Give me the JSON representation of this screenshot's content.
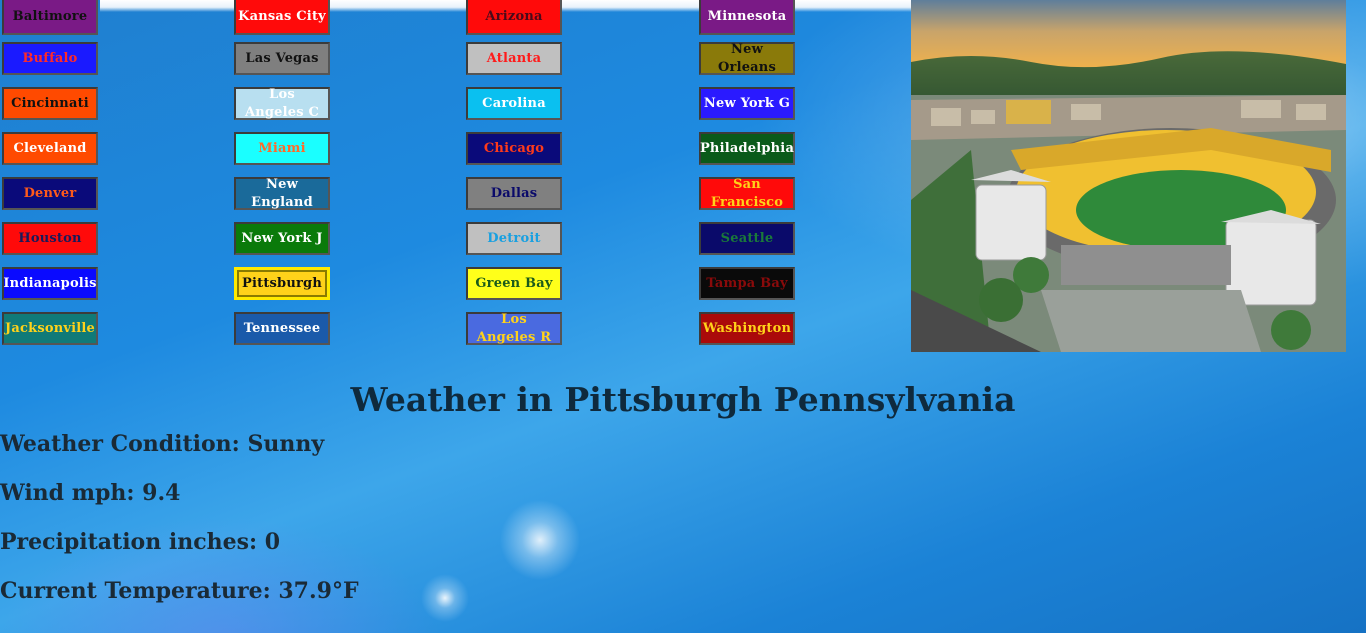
{
  "teams": {
    "col1": [
      {
        "label": "Baltimore",
        "bg": "#7a1a86",
        "fg": "#111111"
      },
      {
        "label": "Buffalo",
        "bg": "#1a1aff",
        "fg": "#ff2a2a"
      },
      {
        "label": "Cincinnati",
        "bg": "#ff4a00",
        "fg": "#111111"
      },
      {
        "label": "Cleveland",
        "bg": "#ff4a00",
        "fg": "#ffffff"
      },
      {
        "label": "Denver",
        "bg": "#0a0a7a",
        "fg": "#ff5a1a"
      },
      {
        "label": "Houston",
        "bg": "#ff0a0a",
        "fg": "#1a1a5a"
      },
      {
        "label": "Indianapolis",
        "bg": "#0a0aff",
        "fg": "#ffffff"
      },
      {
        "label": "Jacksonville",
        "bg": "#107a78",
        "fg": "#ffd21a"
      }
    ],
    "col2": [
      {
        "label": "Kansas City",
        "bg": "#ff0a0a",
        "fg": "#ffffff"
      },
      {
        "label": "Las Vegas",
        "bg": "#7f7f7f",
        "fg": "#111111"
      },
      {
        "label": "Los Angeles C",
        "bg": "#b8dff0",
        "fg": "#ffffff"
      },
      {
        "label": "Miami",
        "bg": "#1affff",
        "fg": "#ff6a2a"
      },
      {
        "label": "New England",
        "bg": "#1a6a9a",
        "fg": "#ffffff"
      },
      {
        "label": "New York J",
        "bg": "#0a7a0a",
        "fg": "#ffffff"
      },
      {
        "label": "Pittsburgh",
        "bg": "#ffd21a",
        "fg": "#111111",
        "active": true
      },
      {
        "label": "Tennessee",
        "bg": "#1a5aaa",
        "fg": "#ffffff"
      }
    ],
    "col3": [
      {
        "label": "Arizona",
        "bg": "#ff0a0a",
        "fg": "#4a0a1a"
      },
      {
        "label": "Atlanta",
        "bg": "#c0c0c0",
        "fg": "#ff1a1a"
      },
      {
        "label": "Carolina",
        "bg": "#0ac0f0",
        "fg": "#ffffff"
      },
      {
        "label": "Chicago",
        "bg": "#0a0a7a",
        "fg": "#ff3a1a"
      },
      {
        "label": "Dallas",
        "bg": "#808080",
        "fg": "#0a0a6a"
      },
      {
        "label": "Detroit",
        "bg": "#c0c0c0",
        "fg": "#1aa0e0"
      },
      {
        "label": "Green Bay",
        "bg": "#ffff1a",
        "fg": "#1a5a1a"
      },
      {
        "label": "Los Angeles R",
        "bg": "#4a6ae0",
        "fg": "#ffd21a"
      }
    ],
    "col4": [
      {
        "label": "Minnesota",
        "bg": "#7a1a86",
        "fg": "#ffffff"
      },
      {
        "label": "New Orleans",
        "bg": "#8a7a0a",
        "fg": "#111111"
      },
      {
        "label": "New York G",
        "bg": "#2a1aff",
        "fg": "#ffffff"
      },
      {
        "label": "Philadelphia",
        "bg": "#0a5a1a",
        "fg": "#ffffff"
      },
      {
        "label": "San Francisco",
        "bg": "#ff0a0a",
        "fg": "#ffd21a"
      },
      {
        "label": "Seattle",
        "bg": "#0a0a6a",
        "fg": "#1a7a3a"
      },
      {
        "label": "Tampa Bay",
        "bg": "#0a0a0a",
        "fg": "#8a0a0a"
      },
      {
        "label": "Washington",
        "bg": "#aa0a0a",
        "fg": "#ffd21a"
      }
    ]
  },
  "heading": "Weather in Pittsburgh Pennsylvania",
  "weather": {
    "condition": "Weather Condition: Sunny",
    "wind": "Wind mph: 9.4",
    "precip": "Precipitation inches: 0",
    "temp": "Current Temperature: 37.9°F"
  }
}
